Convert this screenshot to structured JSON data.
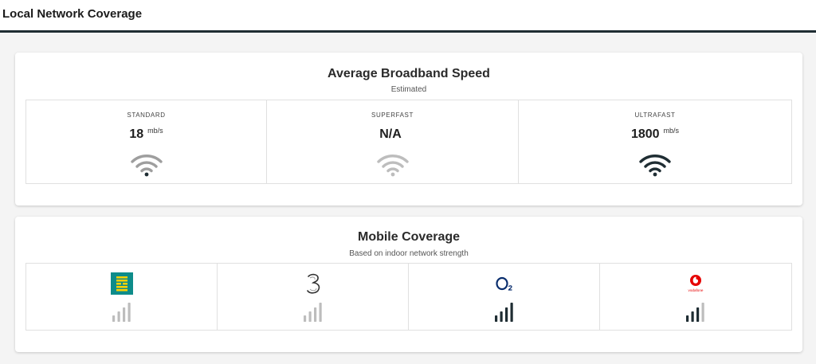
{
  "page": {
    "title": "Local Network Coverage"
  },
  "broadband": {
    "title": "Average Broadband Speed",
    "subtitle": "Estimated",
    "tiers": [
      {
        "label": "STANDARD",
        "speed": "18",
        "unit": "mb/s",
        "signal_icon": "wifi-icon",
        "signal_color": "#9e9e9e",
        "dot_color": "#1f2d33"
      },
      {
        "label": "SUPERFAST",
        "speed": "N/A",
        "unit": "",
        "signal_icon": "wifi-icon",
        "signal_color": "#bdbdbd",
        "dot_color": "#bdbdbd"
      },
      {
        "label": "ULTRAFAST",
        "speed": "1800",
        "unit": "mb/s",
        "signal_icon": "wifi-icon",
        "signal_color": "#1f2d33",
        "dot_color": "#1f2d33"
      }
    ]
  },
  "mobile": {
    "title": "Mobile Coverage",
    "subtitle": "Based on indoor network strength",
    "providers": [
      {
        "logo": "ee-logo",
        "logo_text": "EE",
        "signal_level": 0,
        "active_color": "#1f2d33",
        "inactive_color": "#bdbdbd"
      },
      {
        "logo": "three-logo",
        "logo_text": "3",
        "signal_level": 0,
        "active_color": "#1f2d33",
        "inactive_color": "#bdbdbd"
      },
      {
        "logo": "o2-logo",
        "logo_text": "O2",
        "signal_level": 4,
        "active_color": "#1f2d33",
        "inactive_color": "#bdbdbd"
      },
      {
        "logo": "vodafone-logo",
        "logo_text": "vodafone",
        "signal_level": 3,
        "active_color": "#1f2d33",
        "inactive_color": "#bdbdbd"
      }
    ]
  },
  "colors": {
    "topbar_border": "#1f2d33",
    "ee_teal": "#0e8c8a",
    "ee_yellow": "#ffd200",
    "o2_blue": "#0a2e6e",
    "vodafone_red": "#e60000"
  }
}
